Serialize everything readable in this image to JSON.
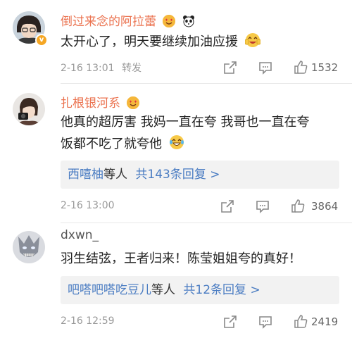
{
  "comments": [
    {
      "username": "倒过来念的阿拉蕾",
      "username_color": "#eb7350",
      "badges": [
        "heart-face-emoji",
        "panda-emoji"
      ],
      "verified_badge": true,
      "text": "太开心了，明天要继续加油应援",
      "text_emoji": "cheering-face-emoji",
      "time": "2-16 13:01",
      "repost_label": "转发",
      "likes": "1532"
    },
    {
      "username": "扎根银河系",
      "username_color": "#eb7350",
      "badges": [
        "heart-face-emoji"
      ],
      "text_line1": "他真的超厉害 我妈一直在夸 我哥也一直在夸",
      "text_line2": "饭都不吃了就夸他",
      "text_emoji": "laughing-tears-emoji",
      "reply_names": "西嘻柚",
      "reply_suffix": "等人",
      "reply_count": "共143条回复 >",
      "time": "2-16 13:00",
      "likes": "3864"
    },
    {
      "username": "dxwn_",
      "username_color": "#555555",
      "text": "羽生结弦，王者归来！陈莹姐姐夸的真好！",
      "reply_names": "吧嗒吧嗒吃豆儿",
      "reply_suffix": "等人",
      "reply_count": "共12条回复 >",
      "time": "2-16 12:59",
      "likes": "2419"
    }
  ],
  "icons": [
    "share-icon",
    "comment-icon",
    "like-icon"
  ],
  "colors": {
    "accent": "#eb7350",
    "link": "#4a7cc2",
    "meta": "#999999",
    "reply_bg": "#f2f2f2"
  }
}
